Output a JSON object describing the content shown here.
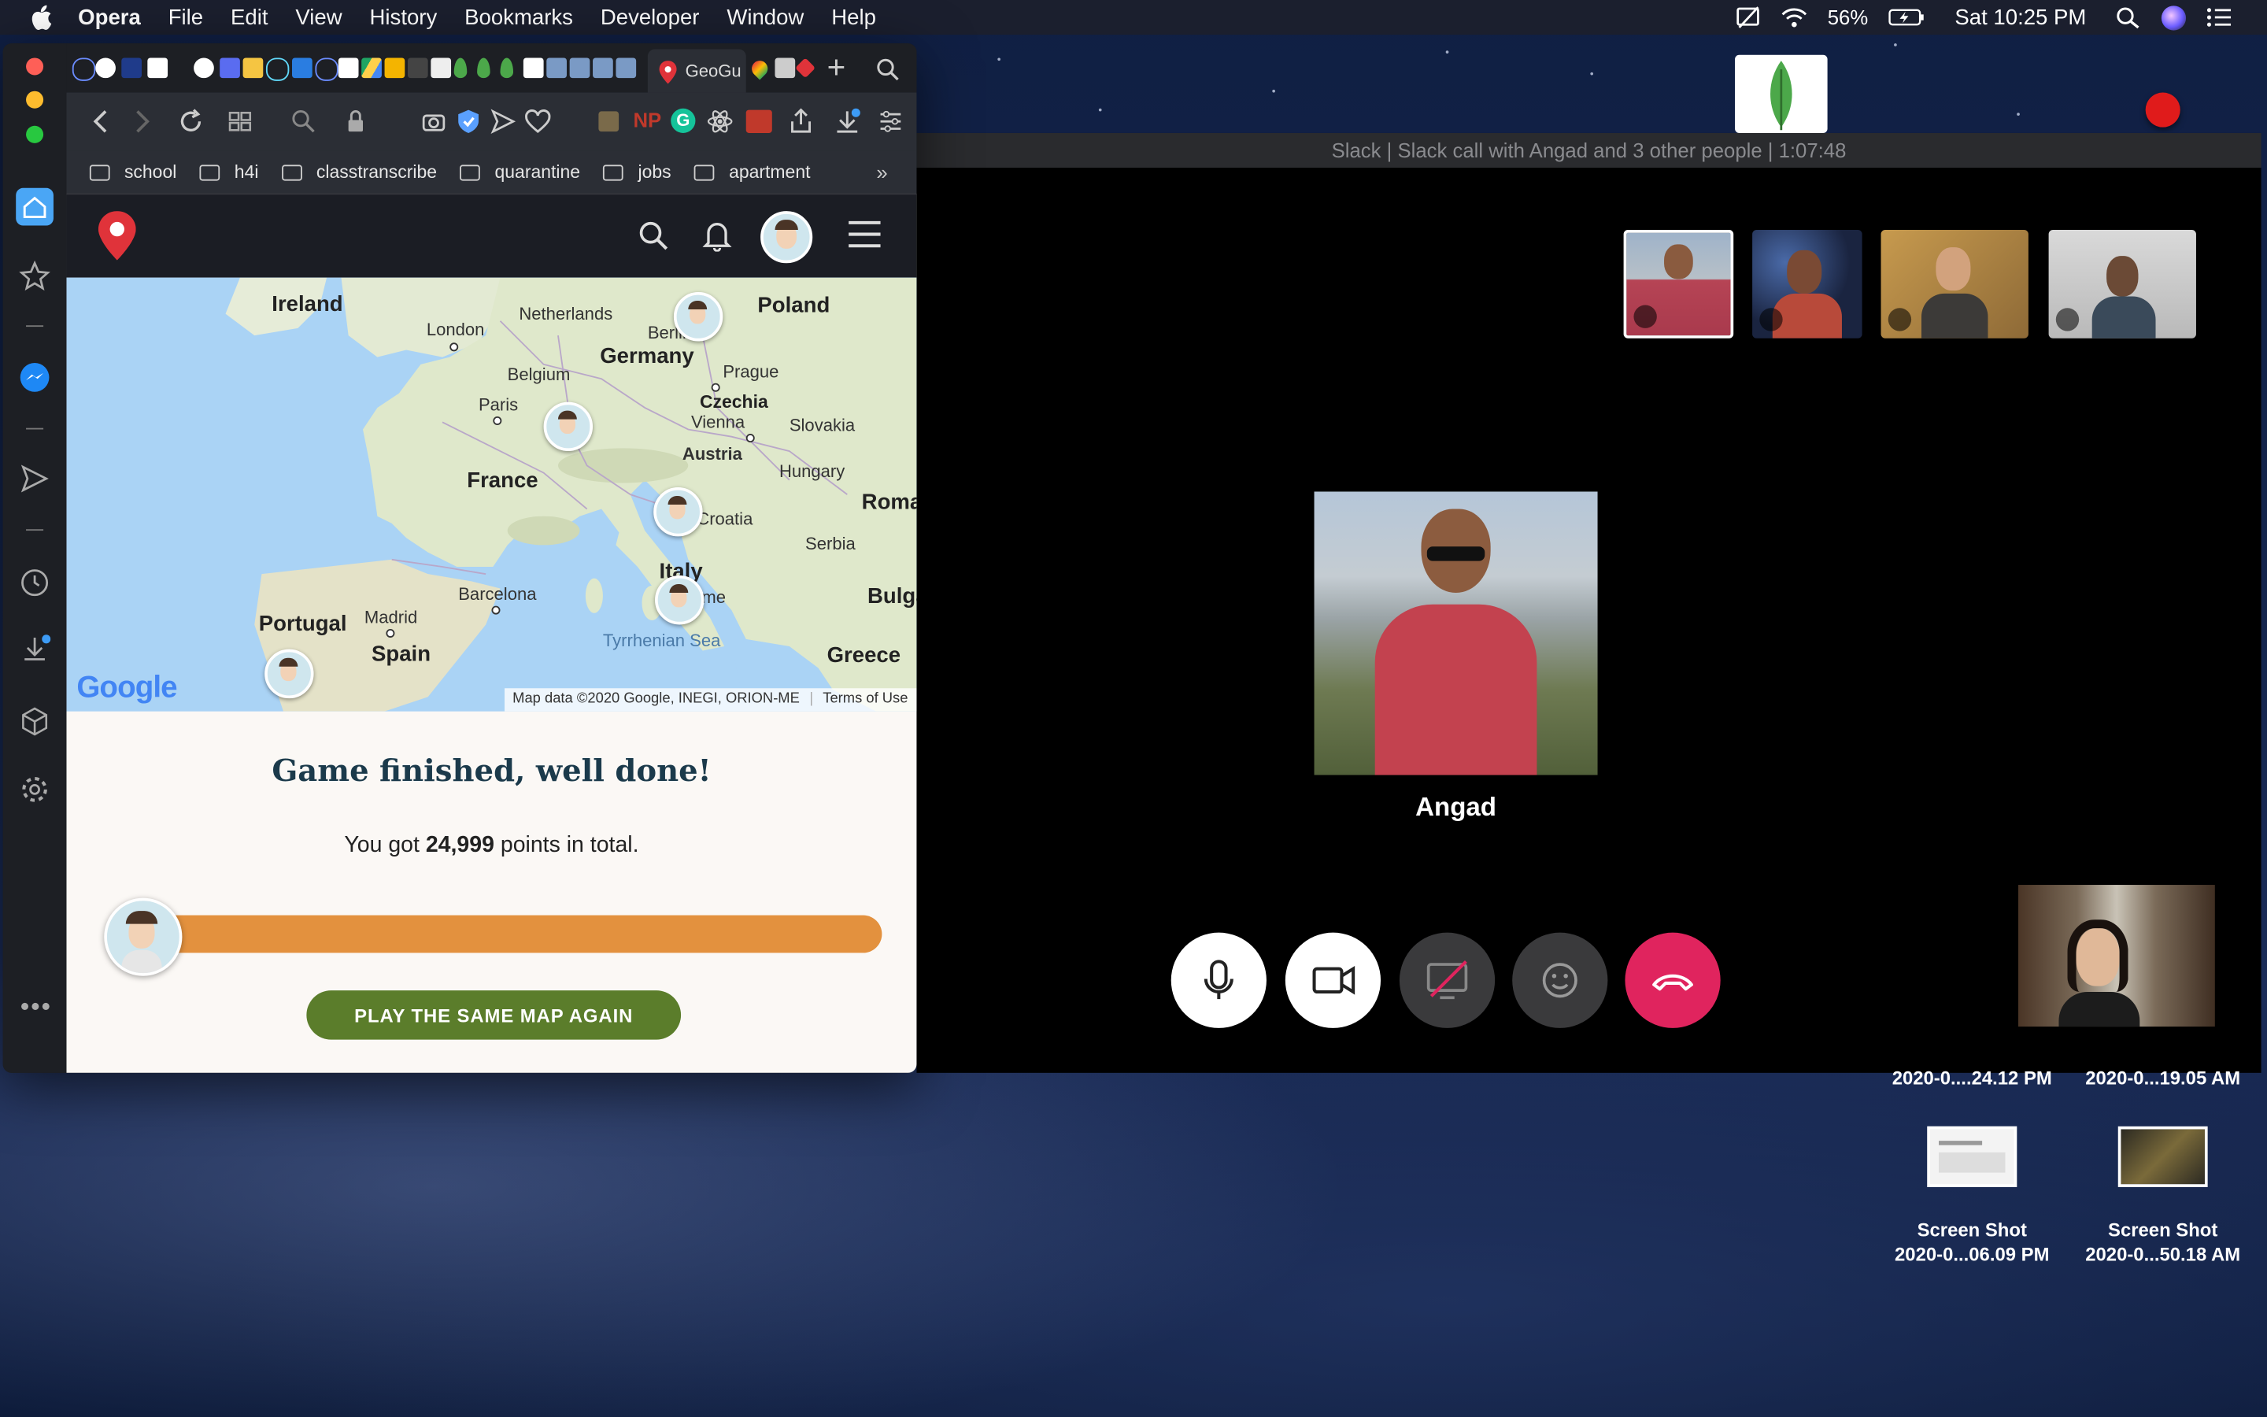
{
  "menubar": {
    "app": "Opera",
    "items": [
      "File",
      "Edit",
      "View",
      "History",
      "Bookmarks",
      "Developer",
      "Window",
      "Help"
    ],
    "battery": "56%",
    "clock": "Sat 10:25 PM"
  },
  "browser": {
    "active_tab_label": "GeoGu",
    "bookmarks": [
      "school",
      "h4i",
      "classtranscribe",
      "quarantine",
      "jobs",
      "apartment"
    ],
    "bookmarks_more": "»"
  },
  "map": {
    "labels": {
      "ireland": "Ireland",
      "netherlands": "Netherlands",
      "poland": "Poland",
      "london": "London",
      "berlin": "Berlin",
      "germany": "Germany",
      "belgium": "Belgium",
      "prague": "Prague",
      "czechia": "Czechia",
      "paris": "Paris",
      "vienna": "Vienna",
      "slovakia": "Slovakia",
      "austria": "Austria",
      "hungary": "Hungary",
      "france": "France",
      "croatia": "Croatia",
      "romania": "Roma",
      "serbia": "Serbia",
      "italy": "Italy",
      "barcelona": "Barcelona",
      "rome": "Rome",
      "bulgaria": "Bulga",
      "portugal": "Portugal",
      "madrid": "Madrid",
      "tyrrhenian": "Tyrrhenian Sea",
      "spain": "Spain",
      "greece": "Greece"
    },
    "google_logo": "Google",
    "attribution": "Map data ©2020 Google, INEGI, ORION-ME",
    "terms": "Terms of Use"
  },
  "result": {
    "title": "Game finished, well done!",
    "points_prefix": "You got ",
    "points_value": "24,999",
    "points_suffix": " points in total.",
    "progress_fraction": 0.99996,
    "play_again": "PLAY THE SAME MAP AGAIN"
  },
  "slack": {
    "window_title": "Slack | Slack call with Angad and 3 other people | 1:07:48",
    "speaker": "Angad",
    "controls": [
      "microphone",
      "video",
      "screen-share-disabled",
      "emoji",
      "hang-up"
    ]
  },
  "desktop": {
    "items": [
      {
        "line1": "",
        "line2": "2020-0....24.12 PM"
      },
      {
        "line1": "",
        "line2": "2020-0...19.05 AM"
      },
      {
        "line1": "Screen Shot",
        "line2": "2020-0...06.09 PM"
      },
      {
        "line1": "Screen Shot",
        "line2": "2020-0...50.18 AM"
      }
    ]
  },
  "colors": {
    "accent_orange": "#e3913e",
    "play_green": "#5b7d2b",
    "hangup_red": "#e0245e",
    "title_navy": "#1b3a4b"
  }
}
